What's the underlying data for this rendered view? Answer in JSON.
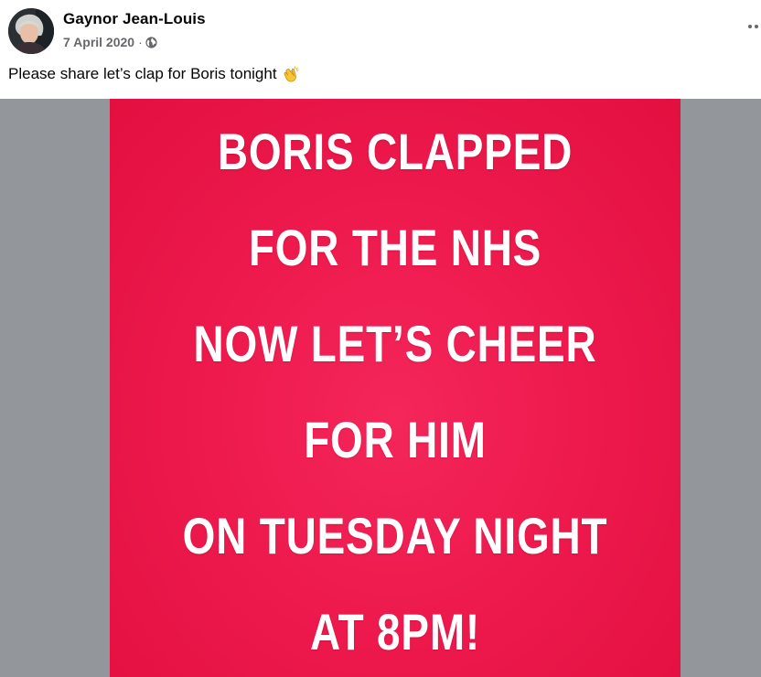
{
  "post": {
    "author": "Gaynor Jean-Louis",
    "date": "7 April 2020",
    "separator": "·",
    "privacy_icon": "globe-icon",
    "menu_icon": "more-options-icon",
    "caption": "Please share let’s clap for Boris tonight",
    "caption_emoji": "clapping-hands-icon",
    "colors": {
      "poster_background": "#ee1a4e",
      "media_backdrop": "#93979c",
      "poster_text": "#ffffff"
    }
  },
  "poster": {
    "lines": [
      "BORIS CLAPPED",
      "FOR THE NHS",
      "NOW LET’S CHEER",
      "FOR HIM",
      "ON TUESDAY NIGHT",
      "AT 8PM!"
    ]
  }
}
